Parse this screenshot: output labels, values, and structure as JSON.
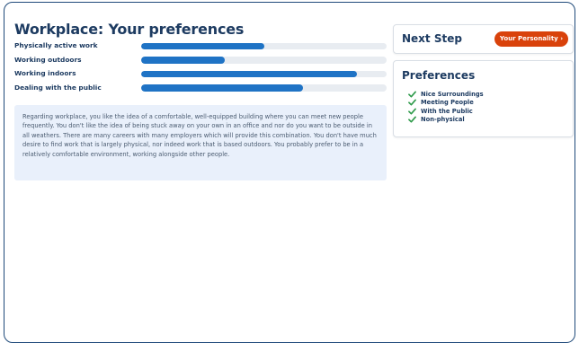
{
  "main": {
    "title": "Workplace: Your preferences",
    "bars": [
      {
        "label": "Physically active work",
        "fraction": 0.5
      },
      {
        "label": "Working outdoors",
        "fraction": 0.34
      },
      {
        "label": "Working indoors",
        "fraction": 0.88
      },
      {
        "label": "Dealing with the public",
        "fraction": 0.66
      }
    ],
    "description": "Regarding workplace, you like the idea of a comfortable, well-equipped building where you can meet new people frequently. You don't like the idea of being stuck away on your own in an office and nor do you want to be outside in all weathers. There are many careers with many employers which will provide this combination. You don't have much desire to find work that is largely physical, nor indeed work that is based outdoors. You probably prefer to be in a relatively comfortable environment, working alongside other people."
  },
  "next_step": {
    "heading": "Next Step",
    "button_label": "Your Personality",
    "button_icon": "chevron-right-icon",
    "button_color": "#d9420b"
  },
  "preferences": {
    "heading": "Preferences",
    "check_icon": "check-icon",
    "check_color": "#2e9a4a",
    "items": [
      "Nice Surroundings",
      "Meeting People",
      "With the Public",
      "Non-physical"
    ]
  },
  "colors": {
    "accent": "#1f73c5",
    "title": "#1d3b61",
    "track": "#e8ecf1",
    "panel": "#e9f0fb"
  }
}
